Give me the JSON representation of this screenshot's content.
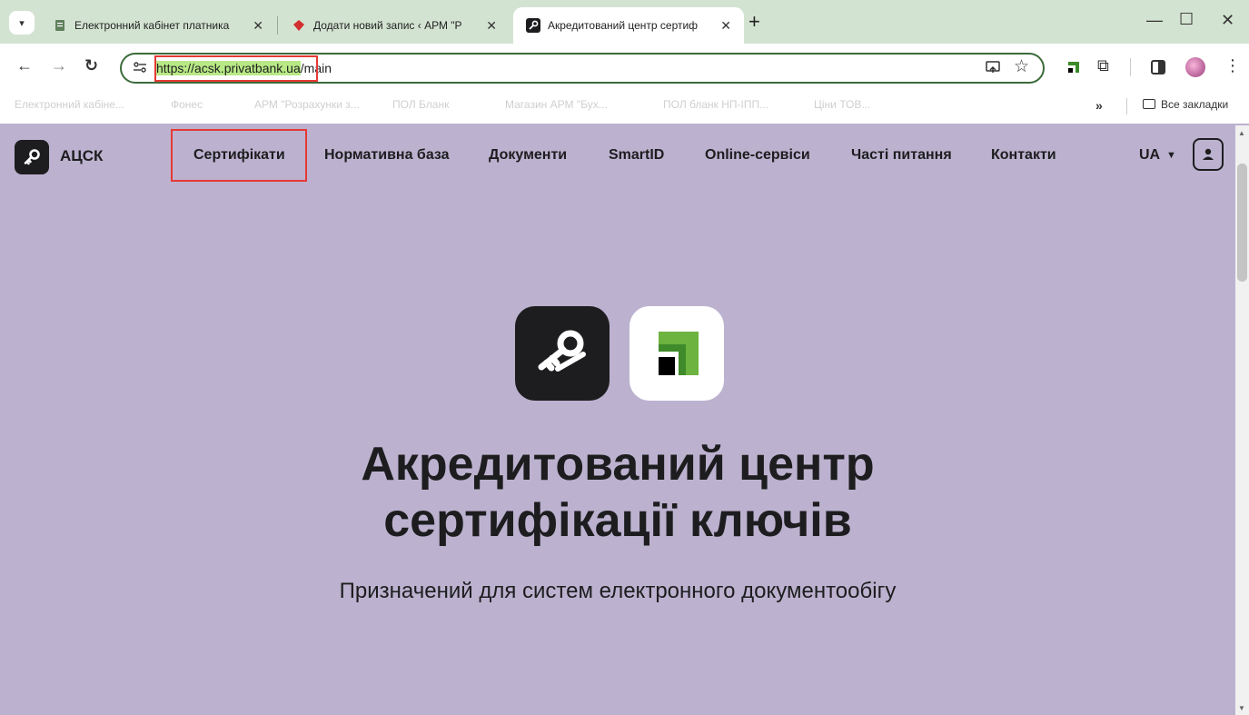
{
  "browser": {
    "tabs": [
      {
        "title": "Електронний кабінет платника",
        "icon": "document-icon"
      },
      {
        "title": "Додати новий запис ‹ АРМ \"Р",
        "icon": "gem-icon"
      },
      {
        "title": "Акредитований центр сертиф",
        "icon": "key-logo-icon"
      }
    ],
    "new_tab_label": "+",
    "window_controls": {
      "minimize": "—",
      "maximize": "☐",
      "close": "✕"
    },
    "url_host": "https://acsk.privatbank.ua",
    "url_path": "/main",
    "bookmarks": [
      "Електронний кабіне...",
      "Фонес",
      "АРМ \"Розрахунки з...",
      "ПОЛ Бланк",
      "Магазин АРМ \"Бух...",
      "ПОЛ бланк НП-ІПП...",
      "Ціни ТОВ..."
    ],
    "bookmarks_more": "»",
    "all_bookmarks_label": "Все закладки"
  },
  "site": {
    "name": "АЦСК",
    "nav": [
      "Сертифікати",
      "Нормативна база",
      "Документи",
      "SmartID",
      "Online-сервіси",
      "Часті питання",
      "Контакти"
    ],
    "lang": "UA"
  },
  "hero": {
    "title_line1": "Акредитований центр",
    "title_line2": "сертифікації ключів",
    "subtitle": "Призначений для систем електронного документообігу"
  },
  "colors": {
    "page_bg": "#bcb2cf",
    "tabstrip_bg": "#d3e3d1",
    "highlight": "#e53935",
    "privat_green": "#6cb33f"
  }
}
